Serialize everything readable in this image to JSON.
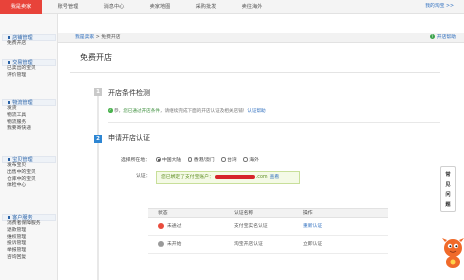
{
  "top_nav": {
    "items": [
      "我是卖家",
      "账号管理",
      "消息中心",
      "卖家地图",
      "采购批发",
      "卖往海外"
    ],
    "active_index": 0,
    "right_link": "我的淘宝 >>"
  },
  "sidebar": {
    "sections": [
      {
        "title": "店铺管理",
        "items": [
          "免费开店"
        ]
      },
      {
        "title": "交易管理",
        "items": [
          "已卖出的宝贝",
          "评价管理"
        ]
      },
      {
        "title": "物流管理",
        "items": [
          "发货",
          "物流工具",
          "物流服务",
          "我要寄快递"
        ]
      },
      {
        "title": "宝贝管理",
        "items": [
          "发布宝贝",
          "出售中的宝贝",
          "仓库中的宝贝",
          "体检中心"
        ]
      },
      {
        "title": "客户服务",
        "items": [
          "消费者保障服务",
          "退款管理",
          "维权管理",
          "投诉管理",
          "举报管理",
          "咨询回复"
        ]
      }
    ]
  },
  "breadcrumb": {
    "root": "我是卖家",
    "separator": " > ",
    "current": "免费开店"
  },
  "help_link": "开店帮助",
  "page_title": "免费开店",
  "step1": {
    "number": "1",
    "title": "开店条件检测",
    "message_prefix": "恭，",
    "message_highlight": "您已通过开店条件",
    "message_body": "，请继续完成下面的开店认证及相关店铺！",
    "message_link": "认证帮助"
  },
  "step2": {
    "number": "2",
    "title": "申请开店认证",
    "location_label": "选择所在地：",
    "location_options": [
      "中国大陆",
      "香港/澳门",
      "台湾",
      "海外"
    ],
    "location_selected": 0,
    "cert_label": "认证：",
    "cert_text_prefix": "您已绑定了支付宝账户：",
    "cert_text_suffix": ".com",
    "cert_view": "查看"
  },
  "table": {
    "headers": [
      "状态",
      "认证名称",
      "操作"
    ],
    "rows": [
      {
        "status_icon": "x-circle-icon",
        "status": "未通过",
        "name": "支付宝实名认证",
        "action": "重新认证"
      },
      {
        "status_icon": "info-icon",
        "status": "未开始",
        "name": "淘宝开店认证",
        "action": "立即认证"
      }
    ]
  },
  "side_tab": {
    "chars": [
      "常",
      "见",
      "问",
      "题"
    ]
  },
  "colors": {
    "brand_red": "#e8433a",
    "link_blue": "#2f6fbf",
    "success_green": "#49b24d",
    "step_blue": "#2e86d3"
  }
}
